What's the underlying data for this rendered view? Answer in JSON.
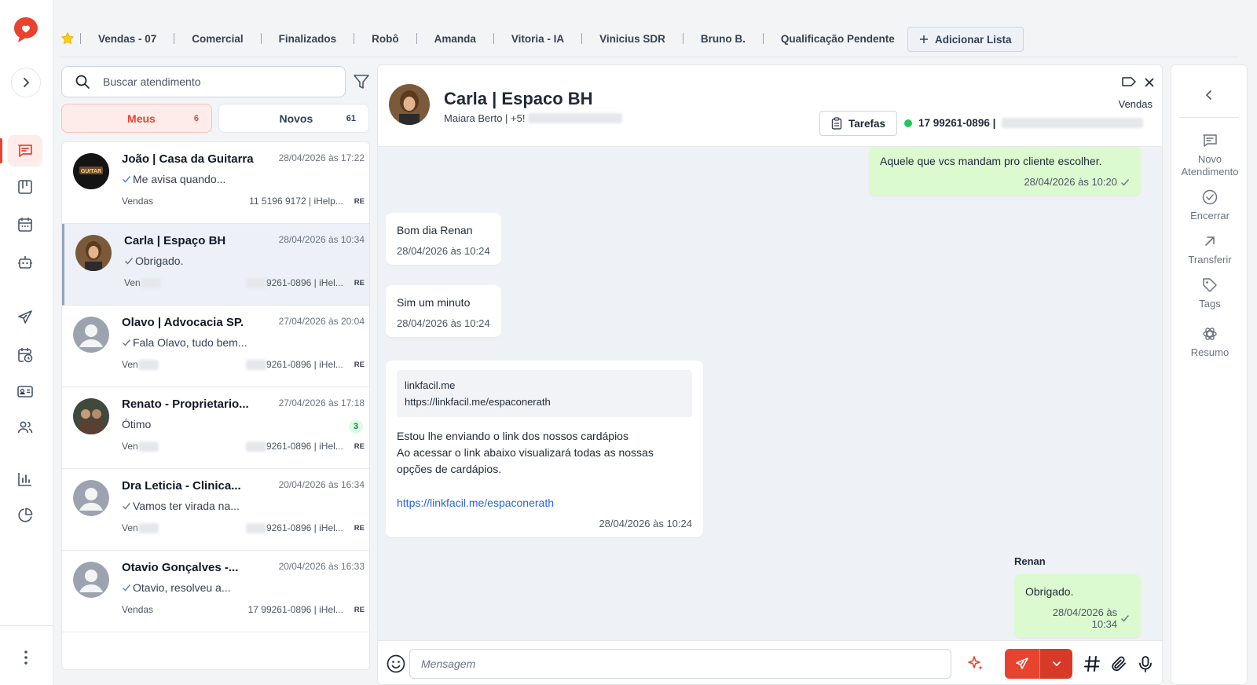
{
  "rail": {
    "items": [
      {
        "name": "chat",
        "icon": "chat-icon",
        "active": true
      },
      {
        "name": "kanban",
        "icon": "kanban-icon"
      },
      {
        "name": "calendar",
        "icon": "calendar-icon"
      },
      {
        "name": "bot",
        "icon": "robot-icon"
      },
      {
        "name": "campaigns",
        "icon": "send-icon"
      },
      {
        "name": "schedule",
        "icon": "calendar-clock-icon"
      },
      {
        "name": "contacts",
        "icon": "id-card-icon"
      },
      {
        "name": "users",
        "icon": "users-icon"
      },
      {
        "name": "reports",
        "icon": "bar-chart-icon"
      },
      {
        "name": "dashboard",
        "icon": "pie-chart-icon"
      }
    ]
  },
  "tabs": [
    "Vendas - 07",
    "Comercial",
    "Finalizados",
    "Robô",
    "Amanda",
    "Vitoria - IA",
    "Vinicius SDR",
    "Bruno B.",
    "Qualificação Pendente"
  ],
  "add_list_label": "Adicionar Lista",
  "search": {
    "placeholder": "Buscar atendimento"
  },
  "segments": {
    "meus": {
      "label": "Meus",
      "count": "6"
    },
    "novos": {
      "label": "Novos",
      "count": "61"
    }
  },
  "conversations": [
    {
      "name": "João | Casa da Guitarra",
      "time": "28/04/2026 às 17:22",
      "preview": "Me avisa quando...",
      "queue": "Vendas",
      "phone": "11 5196 9172 | iHelp...",
      "tag": "RE",
      "read": true
    },
    {
      "name": "Carla | Espaço BH",
      "time": "28/04/2026 às 10:34",
      "preview": "Obrigado.",
      "queue": "Ven",
      "phone": "9261-0896 | iHel...",
      "tag": "RE",
      "read": true
    },
    {
      "name": "Olavo | Advocacia SP.",
      "time": "27/04/2026 às 20:04",
      "preview": "Fala Olavo, tudo bem...",
      "queue": "Ven",
      "phone": "9261-0896 | iHel...",
      "tag": "RE",
      "read": true
    },
    {
      "name": "Renato - Proprietario...",
      "time": "27/04/2026 às 17:18",
      "preview": "Ótimo",
      "queue": "Ven",
      "phone": "9261-0896 | iHel...",
      "tag": "RE",
      "unread": "3"
    },
    {
      "name": "Dra Leticia - Clinica...",
      "time": "20/04/2026 às 16:34",
      "preview": "Vamos ter virada na...",
      "queue": "Ven",
      "phone": "9261-0896 | iHel...",
      "tag": "RE",
      "read": true
    },
    {
      "name": "Otavio Gonçalves -...",
      "time": "20/04/2026 às 16:33",
      "preview": "Otavio, resolveu a...",
      "queue": "Vendas",
      "phone": "17 99261-0896 | iHel...",
      "tag": "RE",
      "read": true
    }
  ],
  "chat": {
    "title": "Carla | Espaco BH",
    "subtitle": "Maiara Berto | +5!",
    "queue": "Vendas",
    "tasks_label": "Tarefas",
    "connection": "17 99261-0896 |",
    "messages": [
      {
        "dir": "out",
        "text": "Aquele que vcs mandam pro cliente escolher.",
        "time": "28/04/2026 às 10:20"
      },
      {
        "dir": "in",
        "text": "Bom dia Renan",
        "time": "28/04/2026 às 10:24"
      },
      {
        "dir": "in",
        "text": "Sim um minuto",
        "time": "28/04/2026 às 10:24"
      },
      {
        "dir": "in",
        "preview_domain": "linkfacil.me",
        "preview_url": "https://linkfacil.me/espaconerath",
        "line1": "Estou lhe enviando o link dos nossos cardápios",
        "line2": "Ao acessar o link abaixo visualizará todas as nossas",
        "line3": "opções de cardápios.",
        "link": "https://linkfacil.me/espaconerath",
        "time": "28/04/2026 às 10:24"
      },
      {
        "dir": "out",
        "sender": "Renan",
        "text": "Obrigado.",
        "time": "28/04/2026 às 10:34"
      }
    ],
    "composer_placeholder": "Mensagem"
  },
  "actions": [
    {
      "label": "Novo Atendimento",
      "icon": "chat-plus-icon"
    },
    {
      "label": "Encerrar",
      "icon": "check-circle-icon"
    },
    {
      "label": "Transferir",
      "icon": "arrow-up-right-icon"
    },
    {
      "label": "Tags",
      "icon": "tag-icon"
    },
    {
      "label": "Resumo",
      "icon": "openai-icon"
    }
  ],
  "colors": {
    "brand": "#e8432f",
    "outgoing_bubble": "#dcfad0",
    "online": "#22c55e"
  }
}
